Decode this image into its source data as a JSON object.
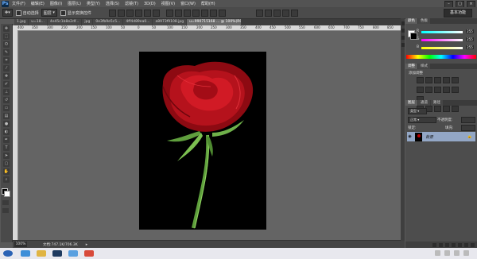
{
  "menubar": {
    "logo": "Ps",
    "items": [
      "文件(F)",
      "编辑(E)",
      "图像(I)",
      "图层(L)",
      "类型(Y)",
      "选择(S)",
      "滤镜(T)",
      "3D(D)",
      "视图(V)",
      "窗口(W)",
      "帮助(H)"
    ]
  },
  "options": {
    "auto_select_label": "自动选择",
    "auto_select_value": "图层",
    "show_transform_label": "显示变换控件",
    "workspace": "基本功能"
  },
  "tabs": [
    {
      "label": "1.jpg",
      "active": false
    },
    {
      "label": "u=18...",
      "active": false
    },
    {
      "label": "4e45c1b8e2df...",
      "active": false
    },
    {
      "label": "jpg",
      "active": false
    },
    {
      "label": "0e3fb9e5c5...",
      "active": false
    },
    {
      "label": "4ff4d89ea0...",
      "active": false
    },
    {
      "label": "a8973f9108.jpg",
      "active": false
    },
    {
      "label": "u=990715168 ... @ 100%(RGB/8#)",
      "active": true
    }
  ],
  "ruler_ticks": [
    "400",
    "350",
    "300",
    "250",
    "200",
    "150",
    "100",
    "50",
    "0",
    "50",
    "100",
    "150",
    "200",
    "250",
    "300",
    "350",
    "400",
    "450",
    "500",
    "550",
    "600",
    "650",
    "700",
    "750",
    "800",
    "850"
  ],
  "status": {
    "zoom": "100%",
    "doc_info": "文档:747.1K/706.3K"
  },
  "color_panel": {
    "tabs": [
      "颜色",
      "色板"
    ],
    "r_label": "R",
    "r_value": "255",
    "g_label": "G",
    "g_value": "255",
    "b_label": "B",
    "b_value": "255"
  },
  "adjust_panel": {
    "tabs": [
      "调整",
      "样式"
    ],
    "heading": "添加调整"
  },
  "layers_panel": {
    "tabs": [
      "图层",
      "通道",
      "路径"
    ],
    "kind_label": "类型",
    "blend_mode": "正常",
    "opacity_label": "不透明度:",
    "fill_label": "填充:",
    "lock_label": "锁定:",
    "layer_name": "背景"
  },
  "colors": {
    "accent_selected_layer": "#93a7c6",
    "photo_background": "#000000",
    "rose_red": "#c0101b",
    "stem_green": "#6fb04a"
  }
}
